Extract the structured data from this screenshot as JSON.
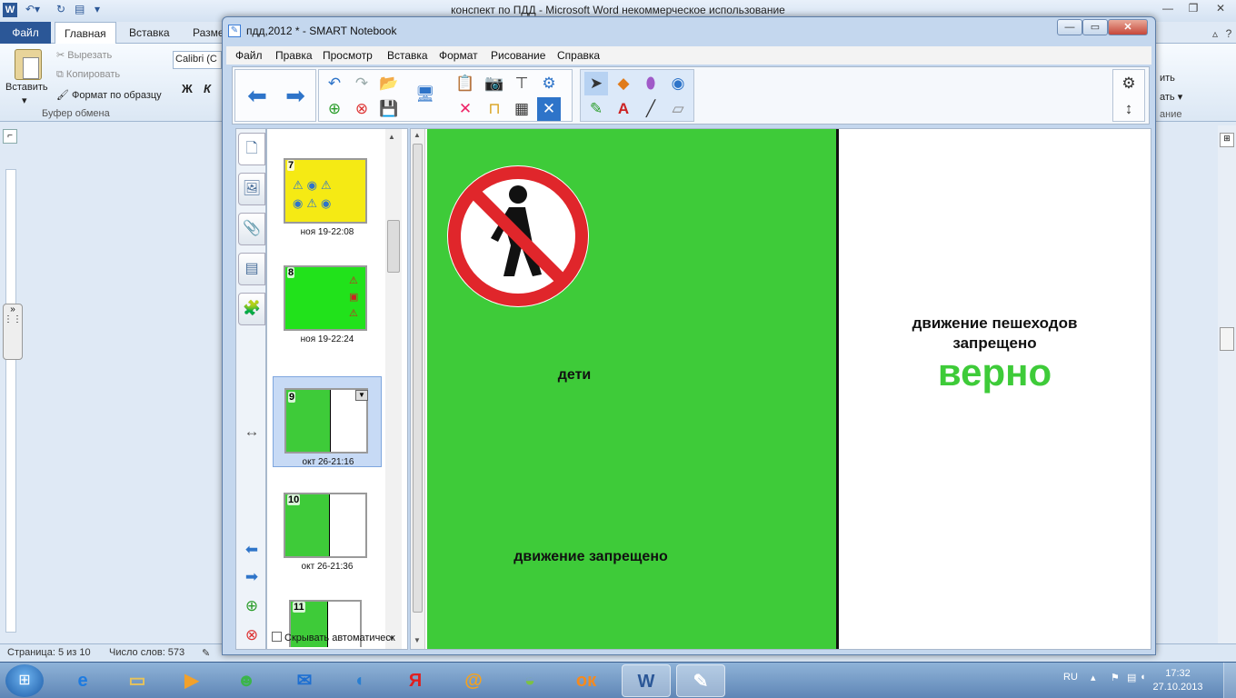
{
  "word": {
    "title": "конспект по ПДД - Microsoft Word некоммерческое использование",
    "logo": "W",
    "tabs": [
      "Файл",
      "Главная",
      "Вставка",
      "Разме"
    ],
    "clipboard": {
      "paste": "Вставить",
      "cut": "Вырезать",
      "copy": "Копировать",
      "format_painter": "Формат по образцу",
      "group_label": "Буфер обмена"
    },
    "font_name": "Calibri (С",
    "bold": "Ж",
    "italic": "К",
    "right_ribbon": {
      "line1": "ить",
      "line2": "ать",
      "group": "ание"
    },
    "status": {
      "page": "Страница: 5 из 10",
      "words": "Число слов: 573"
    }
  },
  "smart": {
    "title": "пдд,2012 * - SMART Notebook",
    "menu": [
      "Файл",
      "Правка",
      "Просмотр",
      "Вставка",
      "Формат",
      "Рисование",
      "Справка"
    ],
    "thumbnails": [
      {
        "num": "7",
        "label": "ноя 19-22:08",
        "bg": "#f5ea14"
      },
      {
        "num": "8",
        "label": "ноя 19-22:24",
        "bg": "#21e21b"
      },
      {
        "num": "9",
        "label": "окт 26-21:16",
        "bg": "#3ecb39"
      },
      {
        "num": "10",
        "label": "окт 26-21:36",
        "bg": "#3ecb39"
      },
      {
        "num": "11",
        "label": "",
        "bg": "#3ecb39"
      }
    ],
    "hide_auto": "Скрывать автоматическ",
    "canvas": {
      "left_color": "#3ecb39",
      "word_children": "дети",
      "word_no_traffic": "движение запрещено",
      "answer_line1": "движение пешеходов",
      "answer_line2": "запрещено",
      "answer_result": "верно",
      "result_color": "#3ecb39"
    }
  },
  "taskbar": {
    "lang": "RU",
    "time": "17:32",
    "date": "27.10.2013",
    "items": [
      "ie-icon",
      "explorer-icon",
      "media-icon",
      "messenger-icon",
      "mail-icon",
      "volume-icon",
      "yandex-icon",
      "mail-ru-icon",
      "chrome-icon",
      "odnoklassniki-icon",
      "word-icon",
      "smart-notebook-icon"
    ]
  }
}
